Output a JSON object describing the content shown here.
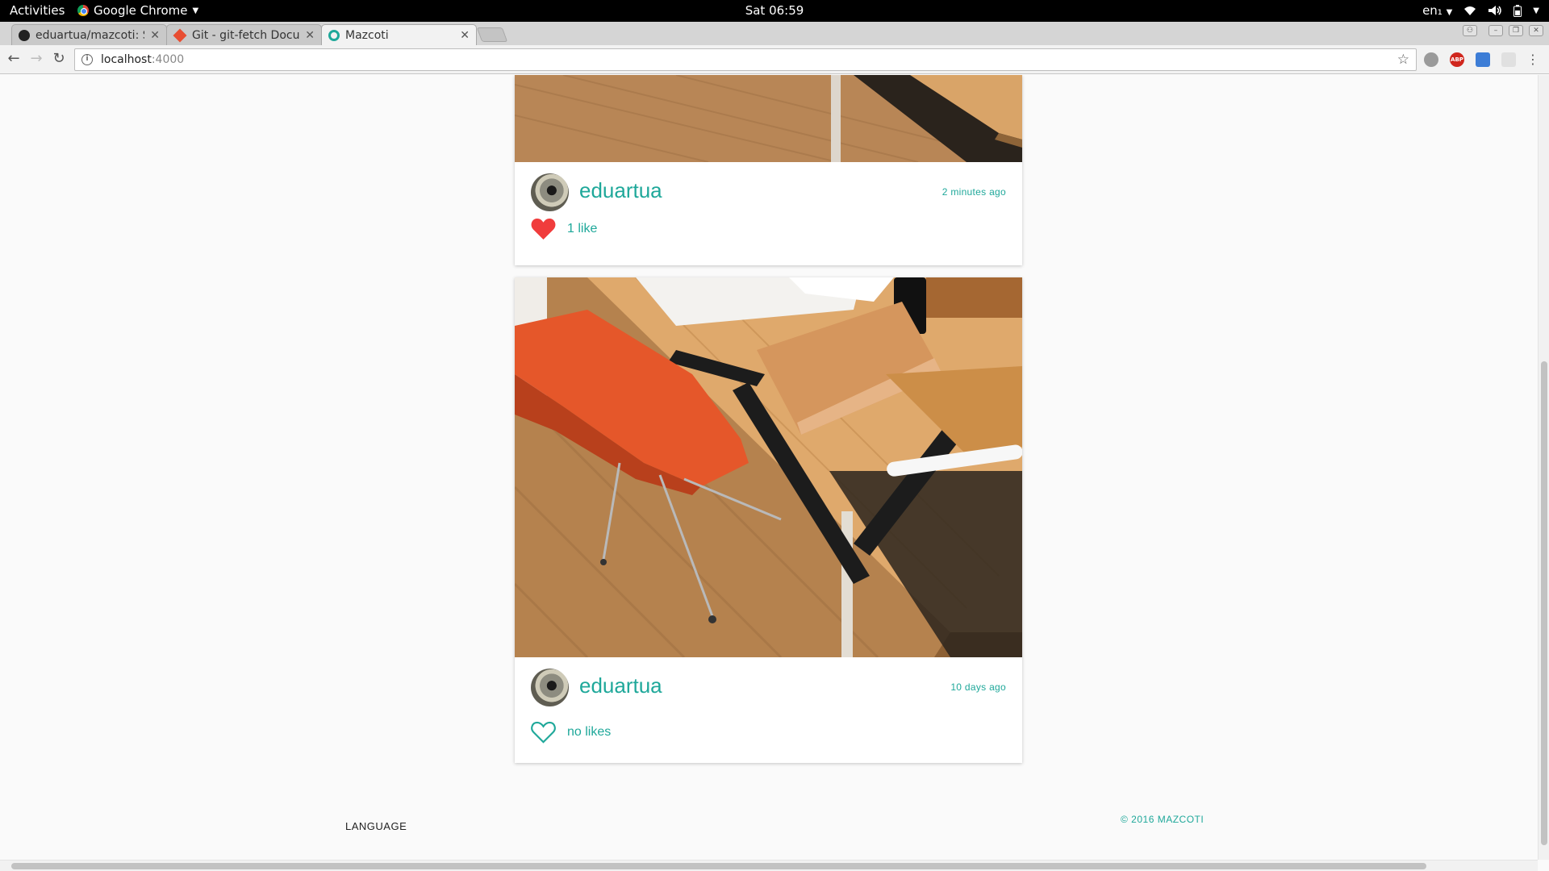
{
  "system_bar": {
    "activities": "Activities",
    "app_name": "Google Chrome",
    "clock": "Sat 06:59",
    "keyboard_layout": "en₁"
  },
  "browser": {
    "tabs": [
      {
        "title": "eduartua/mazcoti: S",
        "icon": "github-icon",
        "active": false
      },
      {
        "title": "Git - git-fetch Docu",
        "icon": "git-icon",
        "active": false
      },
      {
        "title": "Mazcoti",
        "icon": "mazcoti-icon",
        "active": true
      }
    ],
    "url_host": "localhost",
    "url_port": ":4000"
  },
  "feed": {
    "posts": [
      {
        "username": "eduartua",
        "time_ago": "2 minutes ago",
        "likes_text": "1 like",
        "liked": true
      },
      {
        "username": "eduartua",
        "time_ago": "10 days ago",
        "likes_text": "no likes",
        "liked": false
      }
    ]
  },
  "footer": {
    "language_label": "LANGUAGE",
    "copyright": "© 2016 MAZCOTI"
  },
  "colors": {
    "accent": "#1fa89a",
    "like_red": "#f03c3c",
    "background": "#fafafa"
  }
}
